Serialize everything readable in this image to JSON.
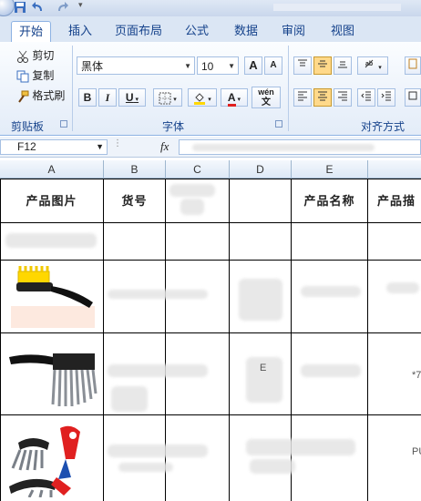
{
  "tabs": [
    "开始",
    "插入",
    "页面布局",
    "公式",
    "数据",
    "审阅",
    "视图"
  ],
  "clipboard": {
    "cut": "剪切",
    "copy": "复制",
    "format_painter": "格式刷",
    "group_label": "剪贴板"
  },
  "font": {
    "name": "黑体",
    "size": "10",
    "grow": "A",
    "shrink": "A",
    "bold": "B",
    "italic": "I",
    "underline": "U",
    "font_color_glyph": "A",
    "phonetic": "wén",
    "group_label": "字体"
  },
  "alignment": {
    "group_label": "对齐方式"
  },
  "formula_bar": {
    "cell_ref": "F12",
    "fx": "fx",
    "value": ""
  },
  "columns": [
    "A",
    "B",
    "C",
    "D",
    "E"
  ],
  "header_row": {
    "a": "产品图片",
    "b": "货号",
    "e": "产品名称",
    "f": "产品描"
  },
  "cells": {
    "r4_d": "E",
    "r4_f": "*7",
    "r5_f": "PU"
  },
  "colors": {
    "ribbon_text": "#15428b",
    "tab_border": "#8db2e3",
    "grid_line": "#000000",
    "highlight_yellow": "#ffd700",
    "font_red": "#e02020"
  }
}
